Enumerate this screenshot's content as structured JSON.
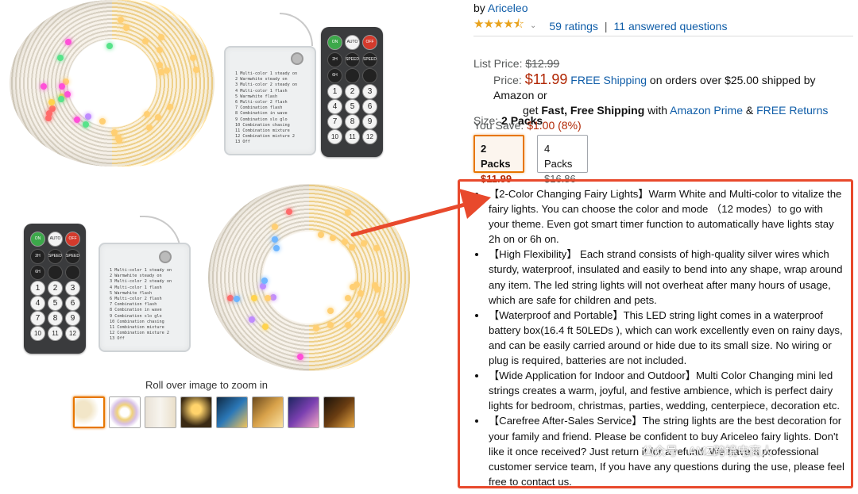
{
  "gallery": {
    "zoom_hint": "Roll over image to zoom in",
    "thumbnail_count": 8,
    "selected_thumbnail": 1,
    "box_label_lines": [
      "1 Multi-color 1 steady on",
      "2 Warmwhite steady on",
      "3 Multi-color 2 steady on",
      "4 Multi-color 1 flash",
      "5 Warmwhite flash",
      "6 Multi-color 2 flash",
      "7 Combination flash",
      "8 Combination in wave",
      "9 Combination slo glo",
      "10 Combination chasing",
      "11 Combination mixture",
      "12 Combination mixture 2",
      "13 Off"
    ],
    "remote_buttons": {
      "row1": [
        "ON",
        "AUTO",
        "OFF"
      ],
      "row2": [
        "2H",
        "SPEED",
        "SPEED"
      ],
      "row3": [
        "6H",
        "",
        ""
      ],
      "numbers": [
        "1",
        "2",
        "3",
        "4",
        "5",
        "6",
        "7",
        "8",
        "9",
        "10",
        "11",
        "12"
      ]
    }
  },
  "product": {
    "by_prefix": "by ",
    "brand": "Ariceleo",
    "stars_display": "★★★★⯪",
    "rating_value": 4.5,
    "ratings_text": "59 ratings",
    "divider": "|",
    "questions_text": "11 answered questions"
  },
  "pricing": {
    "list_price_label": "List Price:",
    "list_price": "$12.99",
    "price_label": "Price:",
    "price": "$11.99",
    "free_shipping": "FREE Shipping",
    "shipping_tail": " on orders over $25.00 shipped by Amazon or",
    "get": "get ",
    "fast_free": "Fast, Free Shipping",
    "with": " with ",
    "prime": "Amazon Prime",
    "amp": " & ",
    "free_returns": "FREE Returns",
    "you_save_label": "You Save:",
    "you_save": "$1.00 (8%)"
  },
  "size": {
    "label": "Size: ",
    "selected": "2 Packs",
    "options": [
      {
        "name": "2 Packs",
        "price": "$11.99"
      },
      {
        "name": "4 Packs",
        "price": "$16.86"
      }
    ]
  },
  "bullets": [
    "【2-Color Changing Fairy Lights】Warm White and Multi-color to vitalize the fairy lights. You can choose the color and mode （12 modes）to go with your theme. Even got smart timer function to automatically have lights stay 2h on or 6h on.",
    "【High Flexibility】 Each strand consists of high-quality silver wires which sturdy, waterproof, insulated and easily to bend into any shape, wrap around any item. The led string lights will not overheat after many hours of usage, which are safe for children and pets.",
    "【Waterproof and Portable】This LED string light comes in a waterproof battery box(16.4 ft 50LEDs ), which can work excellently even on rainy days, and can be easily carried around or hide due to its small size. No wiring or plug is required, batteries are not included.",
    "【Wide Application for Indoor and Outdoor】Multi Color Changing mini led strings creates a warm, joyful, and festive ambience, which is perfect dairy lights for bedroom, christmas, parties, wedding, centerpiece, decoration etc.",
    "【Carefree After-Sales Service】The string lights are the best decoration for your family and friend. Please be confident to buy Ariceleo fairy lights. Don't like it once received? Just return it for a refund. We have a professional customer service team, If you have any questions during the use, please feel free to contact us."
  ],
  "watermark": "公众号 · AMZ跨境电商人",
  "colors": {
    "link": "#0f5da8",
    "price_red": "#b12704",
    "highlight_border": "#e8492c",
    "selected_orange": "#e77600",
    "star": "#e8a21c"
  }
}
